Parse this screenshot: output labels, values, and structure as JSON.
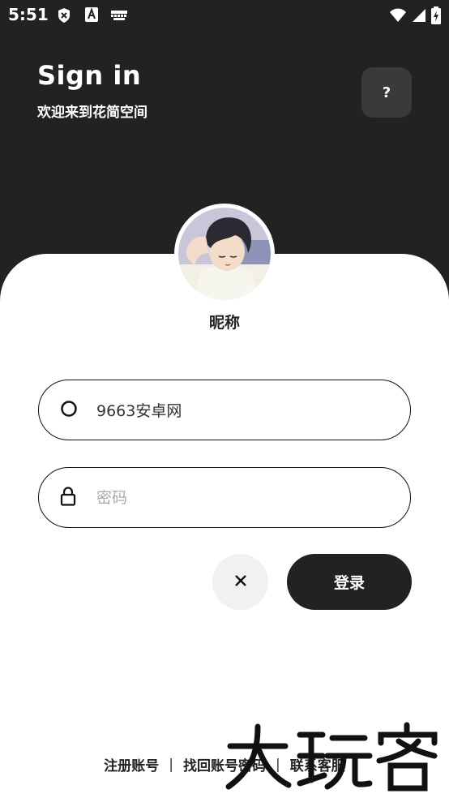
{
  "status_bar": {
    "time": "5:51",
    "left_icons": [
      "shield-x-icon",
      "font-a-icon",
      "keyboard-icon"
    ],
    "right_icons": [
      "wifi-icon",
      "signal-icon",
      "battery-charging-icon"
    ]
  },
  "header": {
    "title": "Sign in",
    "subtitle": "欢迎来到花简空间",
    "help_label": "?"
  },
  "profile": {
    "nickname": "昵称"
  },
  "form": {
    "username_value": "9663安卓网",
    "password_placeholder": "密码",
    "clear_label": "×",
    "login_label": "登录"
  },
  "footer": {
    "register": "注册账号",
    "recover": "找回账号密码",
    "contact": "联系客服",
    "separator": "|"
  },
  "watermark": {
    "text": "大玩客"
  },
  "colors": {
    "header_bg": "#222222",
    "card_bg": "#ffffff",
    "primary_button": "#222222",
    "help_button": "#3a3a3a",
    "clear_button": "#f1f1f1"
  }
}
